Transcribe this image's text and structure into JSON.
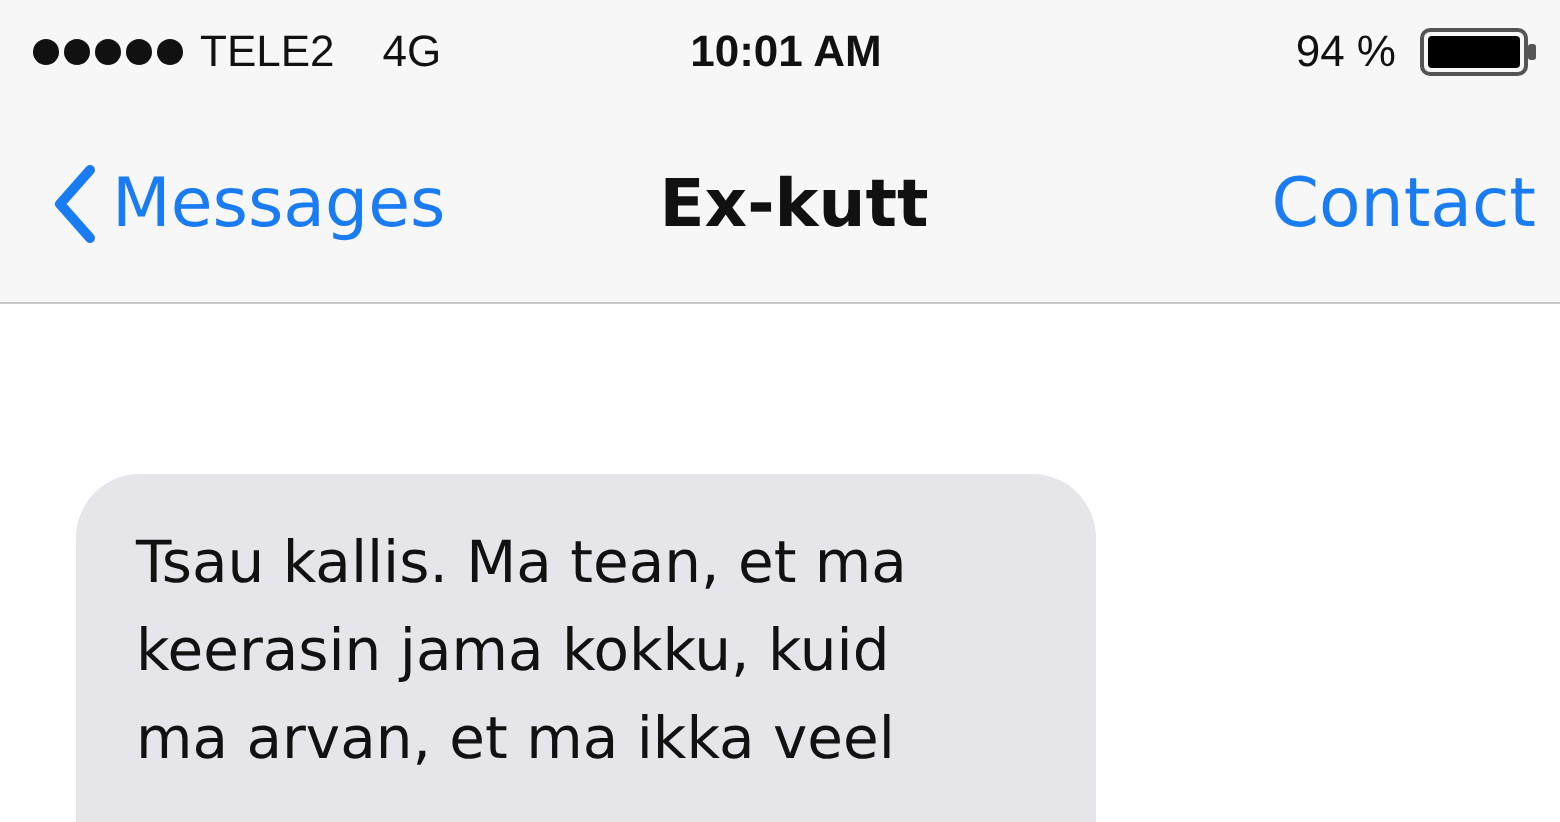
{
  "status_bar": {
    "carrier": "TELE2",
    "network": "4G",
    "time": "10:01 AM",
    "battery": "94 %"
  },
  "nav_bar": {
    "back": "Messages",
    "title": "Ex-kutt",
    "action": "Contact"
  },
  "messages": [
    {
      "kind": "received",
      "text": "Tsau kallis. Ma tean, et ma keerasin jama kokku, kuid ma arvan, et ma ikka veel"
    }
  ]
}
